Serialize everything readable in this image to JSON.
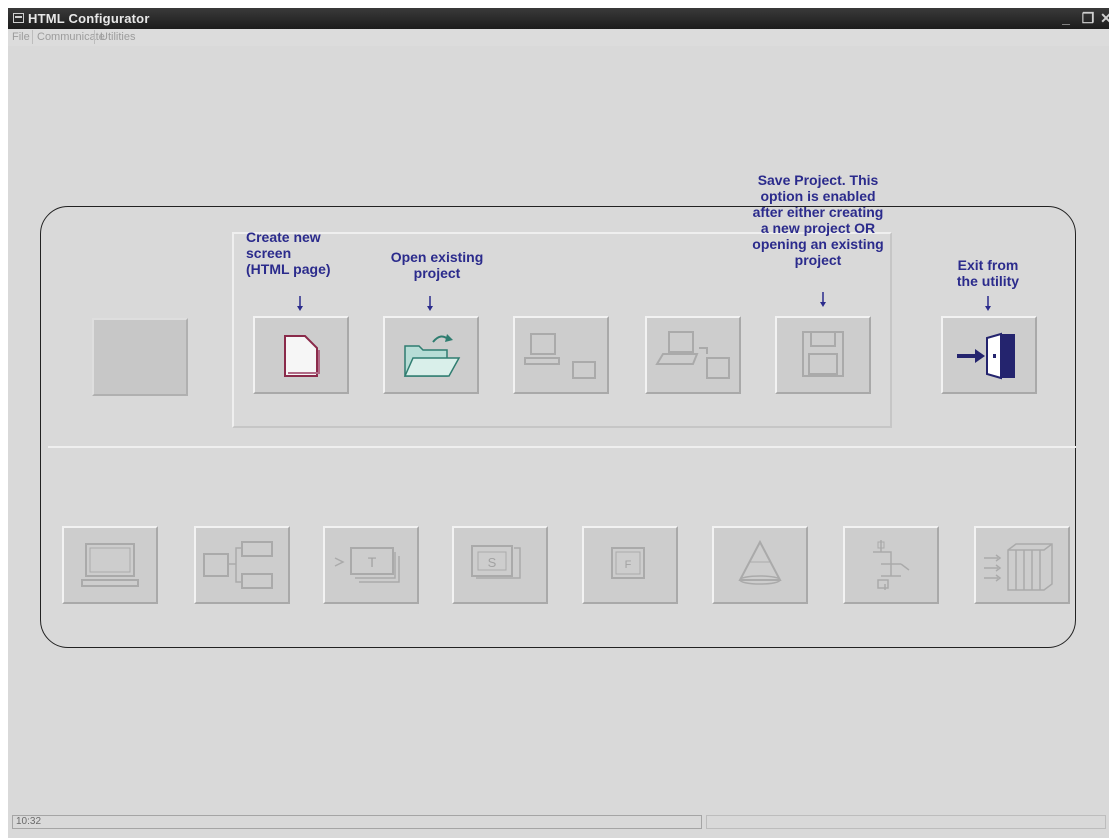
{
  "window": {
    "title": "HTML Configurator",
    "controls": {
      "minimize": "_",
      "maximize": "❐",
      "close": "✕"
    }
  },
  "menu": {
    "items": [
      "File",
      "Communicate",
      "Utilities"
    ]
  },
  "callouts": {
    "new_screen": "Create new\nscreen\n(HTML page)",
    "open_project": "Open existing\nproject",
    "save_project": "Save Project. This\noption is enabled\nafter either creating\na new project OR\nopening an existing\nproject",
    "exit": "Exit from\nthe utility"
  },
  "toolbar_top": [
    {
      "name": "blank",
      "icon": "none",
      "enabled": false
    },
    {
      "name": "new-screen",
      "icon": "new-page-icon",
      "enabled": true
    },
    {
      "name": "open-project",
      "icon": "open-folder-icon",
      "enabled": true
    },
    {
      "name": "download",
      "icon": "computer-transfer-icon",
      "enabled": false
    },
    {
      "name": "upload",
      "icon": "computer-upload-icon",
      "enabled": false
    },
    {
      "name": "save-project",
      "icon": "floppy-disk-icon",
      "enabled": false
    },
    {
      "name": "exit",
      "icon": "exit-door-icon",
      "enabled": true
    }
  ],
  "toolbar_bottom": [
    {
      "name": "screen",
      "icon": "monitor-icon",
      "label": ""
    },
    {
      "name": "screen-map",
      "icon": "screen-map-icon",
      "label": ""
    },
    {
      "name": "text",
      "icon": "text-pages-icon",
      "label": "T"
    },
    {
      "name": "s-object",
      "icon": "s-object-icon",
      "label": "S"
    },
    {
      "name": "f-object",
      "icon": "f-object-icon",
      "label": "F"
    },
    {
      "name": "shape",
      "icon": "cone-icon",
      "label": ""
    },
    {
      "name": "tree",
      "icon": "tree-network-icon",
      "label": ""
    },
    {
      "name": "library",
      "icon": "library-arrows-icon",
      "label": ""
    }
  ],
  "status": {
    "time": "10:32"
  },
  "colors": {
    "callout_text": "#2b2b8c",
    "titlebar": "#262626",
    "window_bg": "#d9d9d9"
  }
}
